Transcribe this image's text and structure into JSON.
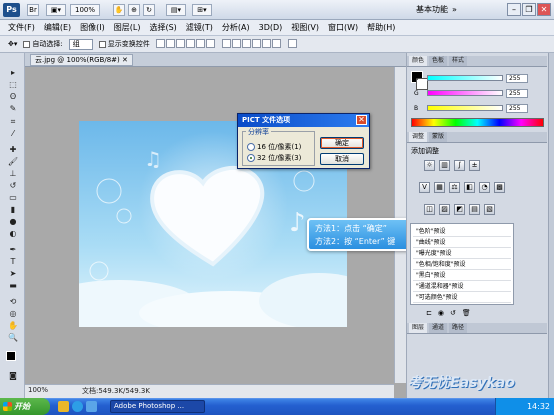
{
  "app": {
    "logo": "Ps",
    "workspace": "基本功能",
    "zoom": "100%"
  },
  "menu": [
    "文件(F)",
    "编辑(E)",
    "图像(I)",
    "图层(L)",
    "选择(S)",
    "滤镜(T)",
    "分析(A)",
    "3D(D)",
    "视图(V)",
    "窗口(W)",
    "帮助(H)"
  ],
  "options": {
    "auto_select_label": "自动选择:",
    "auto_select_value": "组",
    "transform_label": "显示变换控件"
  },
  "document": {
    "tab_label": "云.jpg @ 100%(RGB/8#)",
    "zoom_status": "100%",
    "doc_status": "文档:549.3K/549.3K"
  },
  "dialog": {
    "title": "PICT 文件选项",
    "group_label": "分辨率",
    "option_16": "16 位/像素(1)",
    "option_32": "32 位/像素(3)",
    "ok": "确定",
    "cancel": "取消"
  },
  "callout": {
    "line1": "方法1：点击 “确定”",
    "line2": "方法2：按 “Enter” 键"
  },
  "panels": {
    "color_tabs": [
      "颜色",
      "色板",
      "样式"
    ],
    "r_label": "R",
    "g_label": "G",
    "b_label": "B",
    "r_value": "255",
    "g_value": "255",
    "b_value": "255",
    "adjust_tabs": [
      "调整",
      "蒙版"
    ],
    "adjust_title": "添加调整",
    "presets": [
      "\"色阶\"预设",
      "\"曲线\"预设",
      "\"曝光度\"预设",
      "\"色相/饱和度\"预设",
      "\"黑白\"预设",
      "\"通道混和器\"预设",
      "\"可选颜色\"预设"
    ],
    "layer_tabs": [
      "图层",
      "通道",
      "路径"
    ]
  },
  "taskbar": {
    "start": "开始",
    "task": "Adobe Photoshop ...",
    "time": "14:32"
  },
  "watermark": "考无忧Easykao",
  "colors": {
    "accent": "#2a8fe0",
    "title_bar": "#0a4cc8",
    "sky": "#9fd4f2"
  }
}
